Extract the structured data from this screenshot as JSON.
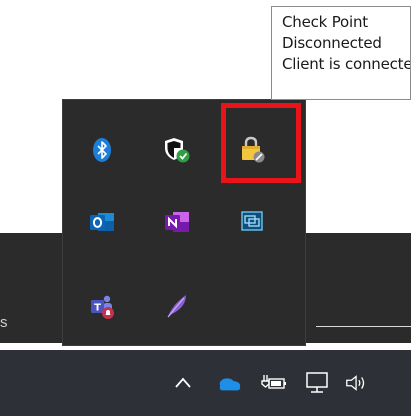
{
  "tooltip": {
    "lines": [
      "Check Point",
      "Disconnected",
      "Client is connected"
    ]
  },
  "background": {
    "fragment_text": "s"
  },
  "tray_flyout": {
    "icons": [
      {
        "name": "bluetooth-icon"
      },
      {
        "name": "windows-security-icon"
      },
      {
        "name": "check-point-vpn-icon"
      },
      {
        "name": "outlook-icon"
      },
      {
        "name": "onenote-icon"
      },
      {
        "name": "remote-connection-icon"
      },
      {
        "name": "teams-icon"
      },
      {
        "name": "feather-app-icon"
      }
    ]
  },
  "taskbar": {
    "icons": [
      "show-hidden-icons-chevron-icon",
      "onedrive-icon",
      "battery-power-icon",
      "network-icon",
      "volume-icon"
    ]
  },
  "colors": {
    "highlight": "#e8141a",
    "flyout_bg": "#2b2b2b",
    "taskbar_bg": "#2e3037"
  }
}
